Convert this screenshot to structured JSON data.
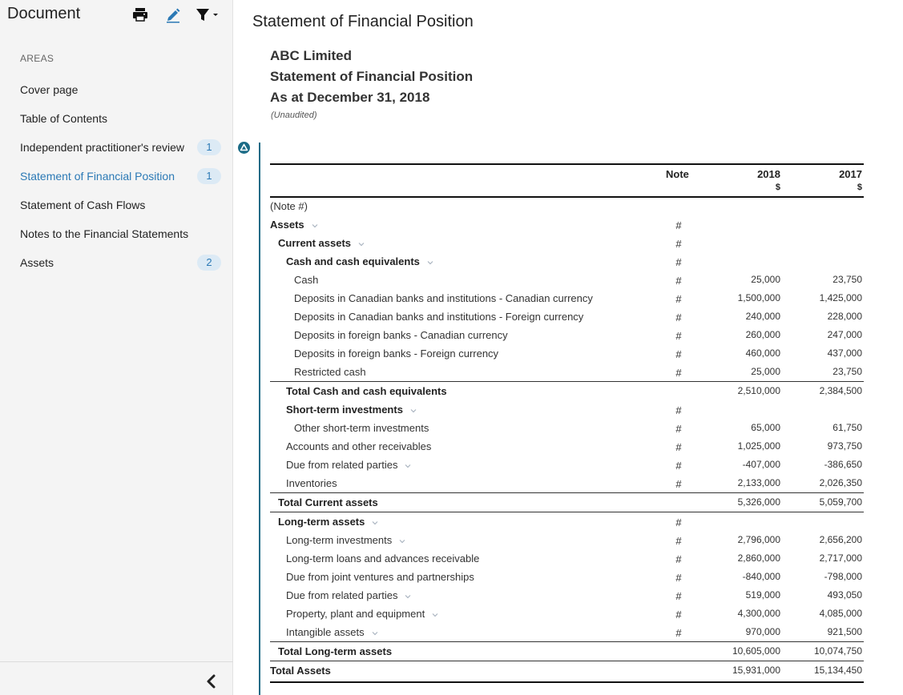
{
  "sidebar": {
    "title": "Document",
    "areas_heading": "AREAS",
    "items": [
      {
        "label": "Cover page",
        "badge": null,
        "active": false
      },
      {
        "label": "Table of Contents",
        "badge": null,
        "active": false
      },
      {
        "label": "Independent practitioner's review",
        "badge": "1",
        "active": false
      },
      {
        "label": "Statement of Financial Position",
        "badge": "1",
        "active": true
      },
      {
        "label": "Statement of Cash Flows",
        "badge": null,
        "active": false
      },
      {
        "label": "Notes to the Financial Statements",
        "badge": null,
        "active": false
      },
      {
        "label": "Assets",
        "badge": "2",
        "active": false
      }
    ],
    "icons": [
      "print-icon",
      "edit-icon",
      "filter-icon",
      "chevron-left-icon"
    ]
  },
  "main": {
    "page_title": "Statement of Financial Position",
    "company": "ABC Limited",
    "statement": "Statement of Financial Position",
    "as_at": "As at December 31, 2018",
    "unaudited": "(Unaudited)"
  },
  "table": {
    "columns": {
      "note": "Note",
      "y2018": "2018",
      "y2018_unit": "$",
      "y2017": "2017",
      "y2017_unit": "$"
    },
    "rows": [
      {
        "label": "(Note #)",
        "note": "",
        "v2018": "",
        "v2017": "",
        "indent": 0,
        "bold": false,
        "chevron": false,
        "style": ""
      },
      {
        "label": "Assets",
        "note": "#",
        "v2018": "",
        "v2017": "",
        "indent": 0,
        "bold": true,
        "chevron": true,
        "style": ""
      },
      {
        "label": "Current assets",
        "note": "#",
        "v2018": "",
        "v2017": "",
        "indent": 1,
        "bold": true,
        "chevron": true,
        "style": ""
      },
      {
        "label": "Cash and cash equivalents",
        "note": "#",
        "v2018": "",
        "v2017": "",
        "indent": 2,
        "bold": true,
        "chevron": true,
        "style": ""
      },
      {
        "label": "Cash",
        "note": "#",
        "v2018": "25,000",
        "v2017": "23,750",
        "indent": 3,
        "bold": false,
        "chevron": false,
        "style": ""
      },
      {
        "label": "Deposits in Canadian banks and institutions - Canadian currency",
        "note": "#",
        "v2018": "1,500,000",
        "v2017": "1,425,000",
        "indent": 3,
        "bold": false,
        "chevron": false,
        "style": ""
      },
      {
        "label": "Deposits in Canadian banks and institutions - Foreign currency",
        "note": "#",
        "v2018": "240,000",
        "v2017": "228,000",
        "indent": 3,
        "bold": false,
        "chevron": false,
        "style": ""
      },
      {
        "label": "Deposits in foreign banks - Canadian currency",
        "note": "#",
        "v2018": "260,000",
        "v2017": "247,000",
        "indent": 3,
        "bold": false,
        "chevron": false,
        "style": ""
      },
      {
        "label": "Deposits in foreign banks - Foreign currency",
        "note": "#",
        "v2018": "460,000",
        "v2017": "437,000",
        "indent": 3,
        "bold": false,
        "chevron": false,
        "style": ""
      },
      {
        "label": "Restricted cash",
        "note": "#",
        "v2018": "25,000",
        "v2017": "23,750",
        "indent": 3,
        "bold": false,
        "chevron": false,
        "style": ""
      },
      {
        "label": "Total Cash and cash equivalents",
        "note": "",
        "v2018": "2,510,000",
        "v2017": "2,384,500",
        "indent": 2,
        "bold": true,
        "chevron": false,
        "style": "total"
      },
      {
        "label": "Short-term investments",
        "note": "#",
        "v2018": "",
        "v2017": "",
        "indent": 2,
        "bold": true,
        "chevron": true,
        "style": ""
      },
      {
        "label": "Other short-term investments",
        "note": "#",
        "v2018": "65,000",
        "v2017": "61,750",
        "indent": 3,
        "bold": false,
        "chevron": false,
        "style": ""
      },
      {
        "label": "Accounts and other receivables",
        "note": "#",
        "v2018": "1,025,000",
        "v2017": "973,750",
        "indent": 2,
        "bold": false,
        "chevron": false,
        "style": ""
      },
      {
        "label": "Due from related parties",
        "note": "#",
        "v2018": "-407,000",
        "v2017": "-386,650",
        "indent": 2,
        "bold": false,
        "chevron": true,
        "style": ""
      },
      {
        "label": "Inventories",
        "note": "#",
        "v2018": "2,133,000",
        "v2017": "2,026,350",
        "indent": 2,
        "bold": false,
        "chevron": false,
        "style": ""
      },
      {
        "label": "Total Current assets",
        "note": "",
        "v2018": "5,326,000",
        "v2017": "5,059,700",
        "indent": 1,
        "bold": true,
        "chevron": false,
        "style": "total"
      },
      {
        "label": "Long-term assets",
        "note": "#",
        "v2018": "",
        "v2017": "",
        "indent": 1,
        "bold": true,
        "chevron": true,
        "style": "total"
      },
      {
        "label": "Long-term investments",
        "note": "#",
        "v2018": "2,796,000",
        "v2017": "2,656,200",
        "indent": 2,
        "bold": false,
        "chevron": true,
        "style": ""
      },
      {
        "label": "Long-term loans and advances receivable",
        "note": "#",
        "v2018": "2,860,000",
        "v2017": "2,717,000",
        "indent": 2,
        "bold": false,
        "chevron": false,
        "style": ""
      },
      {
        "label": "Due from joint ventures and partnerships",
        "note": "#",
        "v2018": "-840,000",
        "v2017": "-798,000",
        "indent": 2,
        "bold": false,
        "chevron": false,
        "style": ""
      },
      {
        "label": "Due from related parties",
        "note": "#",
        "v2018": "519,000",
        "v2017": "493,050",
        "indent": 2,
        "bold": false,
        "chevron": true,
        "style": ""
      },
      {
        "label": "Property, plant and equipment",
        "note": "#",
        "v2018": "4,300,000",
        "v2017": "4,085,000",
        "indent": 2,
        "bold": false,
        "chevron": true,
        "style": ""
      },
      {
        "label": "Intangible assets",
        "note": "#",
        "v2018": "970,000",
        "v2017": "921,500",
        "indent": 2,
        "bold": false,
        "chevron": true,
        "style": ""
      },
      {
        "label": "Total Long-term assets",
        "note": "",
        "v2018": "10,605,000",
        "v2017": "10,074,750",
        "indent": 1,
        "bold": true,
        "chevron": false,
        "style": "total"
      },
      {
        "label": "Total Assets",
        "note": "",
        "v2018": "15,931,000",
        "v2017": "15,134,450",
        "indent": 0,
        "bold": true,
        "chevron": false,
        "style": "grand"
      }
    ]
  },
  "colors": {
    "accent": "#2b79b5",
    "marker": "#1b6b86",
    "badge_bg": "#dceaf5",
    "sidebar_bg": "#f4f4f4"
  }
}
